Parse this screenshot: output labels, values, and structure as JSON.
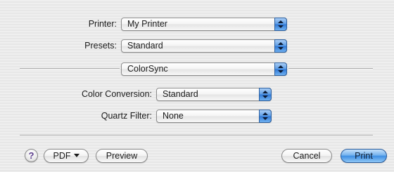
{
  "dialog": {
    "printer": {
      "label": "Printer:",
      "value": "My Printer"
    },
    "presets": {
      "label": "Presets:",
      "value": "Standard"
    },
    "panel_menu": {
      "value": "ColorSync"
    },
    "color_conversion": {
      "label": "Color Conversion:",
      "value": "Standard"
    },
    "quartz_filter": {
      "label": "Quartz Filter:",
      "value": "None"
    }
  },
  "footer": {
    "help_label": "?",
    "pdf_label": "PDF",
    "preview_label": "Preview",
    "cancel_label": "Cancel",
    "print_label": "Print"
  },
  "colors": {
    "default_button": "#4a93e6",
    "popup_arrows": "#3b82dc",
    "background": "#ececec"
  },
  "icons": {
    "help": "question-mark-icon",
    "popup": "up-down-arrows-icon",
    "pdf_menu": "triangle-down-icon"
  }
}
